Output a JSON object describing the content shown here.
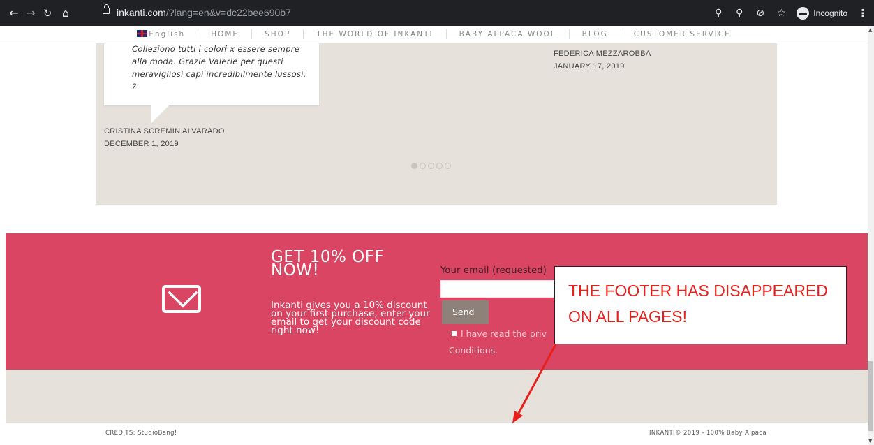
{
  "browser": {
    "url_host": "inkanti.com",
    "url_path": "/?lang=en&v=dc22bee690b7",
    "incognito_label": "Incognito",
    "icons": [
      "back-icon",
      "forward-icon",
      "reload-icon",
      "home-icon",
      "lock-icon",
      "key-icon",
      "zoom-icon",
      "eye-off-icon",
      "star-icon",
      "incognito-icon",
      "menu-icon"
    ]
  },
  "nav": {
    "language": "English",
    "items": [
      "HOME",
      "SHOP",
      "THE WORLD OF INKANTI",
      "BABY ALPACA WOOL",
      "BLOG",
      "CUSTOMER SERVICE"
    ]
  },
  "testimonials": {
    "quote": "Colleziono tutti i colori x essere sempre alla moda. Grazie Valerie per questi meravigliosi capi incredibilmente lussosi. ?",
    "author1_name": "CRISTINA SCREMIN ALVARADO",
    "author1_date": "DECEMBER 1, 2019",
    "author2_name": "FEDERICA MEZZAROBBA",
    "author2_date": "JANUARY 17, 2019",
    "dots_count": 5,
    "active_dot": 1
  },
  "promo": {
    "title": "GET 10% OFF NOW!",
    "description": "Inkanti gives you a 10% discount on your first purchase, enter your email to get your discount code right now!",
    "email_label": "Your email (requested)",
    "email_value": "",
    "send_label": "Send",
    "consent_text": "I have read the priv",
    "consent_text_2": "Conditions."
  },
  "annotation": {
    "text": "THE FOOTER HAS DISAPPEARED ON ALL PAGES!",
    "color": "#e8201c"
  },
  "footer": {
    "credits": "CREDITS: StudioBang!",
    "copyright": "INKANTI© 2019 - 100% Baby Alpaca"
  },
  "colors": {
    "promo_bg": "#d94562",
    "beige": "#e6e1db",
    "chrome_bg": "#202124"
  }
}
